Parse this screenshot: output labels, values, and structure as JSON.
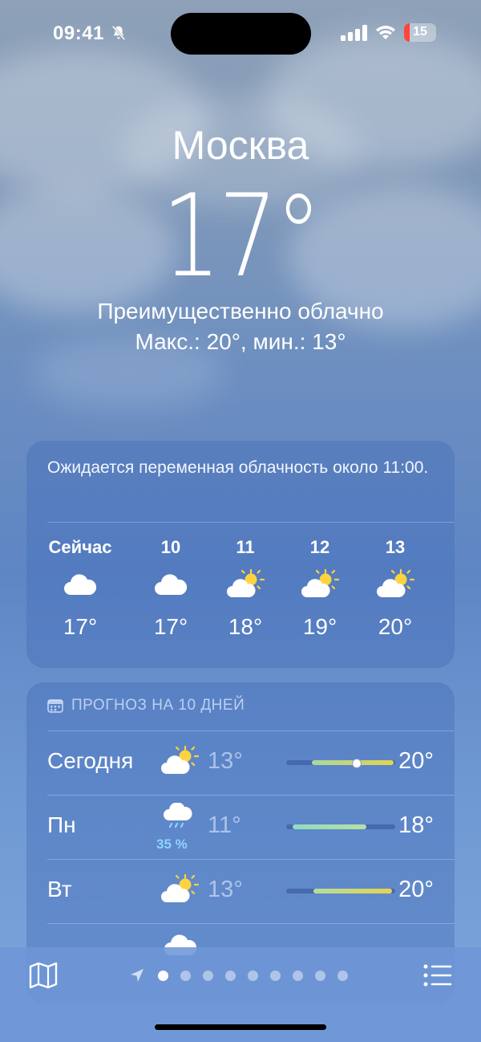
{
  "status": {
    "time": "09:41",
    "battery": "15"
  },
  "header": {
    "city": "Москва",
    "temperature": "17°",
    "condition": "Преимущественно облачно",
    "hilo": "Макс.: 20°, мин.: 13°"
  },
  "hourly": {
    "summary": "Ожидается переменная облачность около 11:00.",
    "items": [
      {
        "label": "Сейчас",
        "icon": "cloud-icon",
        "temp": "17°"
      },
      {
        "label": "10",
        "icon": "cloud-icon",
        "temp": "17°"
      },
      {
        "label": "11",
        "icon": "partly-sunny-icon",
        "temp": "18°"
      },
      {
        "label": "12",
        "icon": "partly-sunny-icon",
        "temp": "19°"
      },
      {
        "label": "13",
        "icon": "partly-sunny-icon",
        "temp": "20°"
      }
    ]
  },
  "daily": {
    "title": "ПРОГНОЗ НА 10 ДНЕЙ",
    "rows": [
      {
        "day": "Сегодня",
        "icon": "partly-sunny-icon",
        "precip": "",
        "low": "13°",
        "high": "20°"
      },
      {
        "day": "Пн",
        "icon": "rain-cloud-icon",
        "precip": "35 %",
        "low": "11°",
        "high": "18°"
      },
      {
        "day": "Вт",
        "icon": "partly-sunny-icon",
        "precip": "",
        "low": "13°",
        "high": "20°"
      }
    ]
  },
  "pager": {
    "pages": 9,
    "active": 0
  },
  "colors": {
    "accent_blue": "#8fd3ff",
    "battery_low": "#ff453a",
    "sun": "#ffd23f"
  }
}
